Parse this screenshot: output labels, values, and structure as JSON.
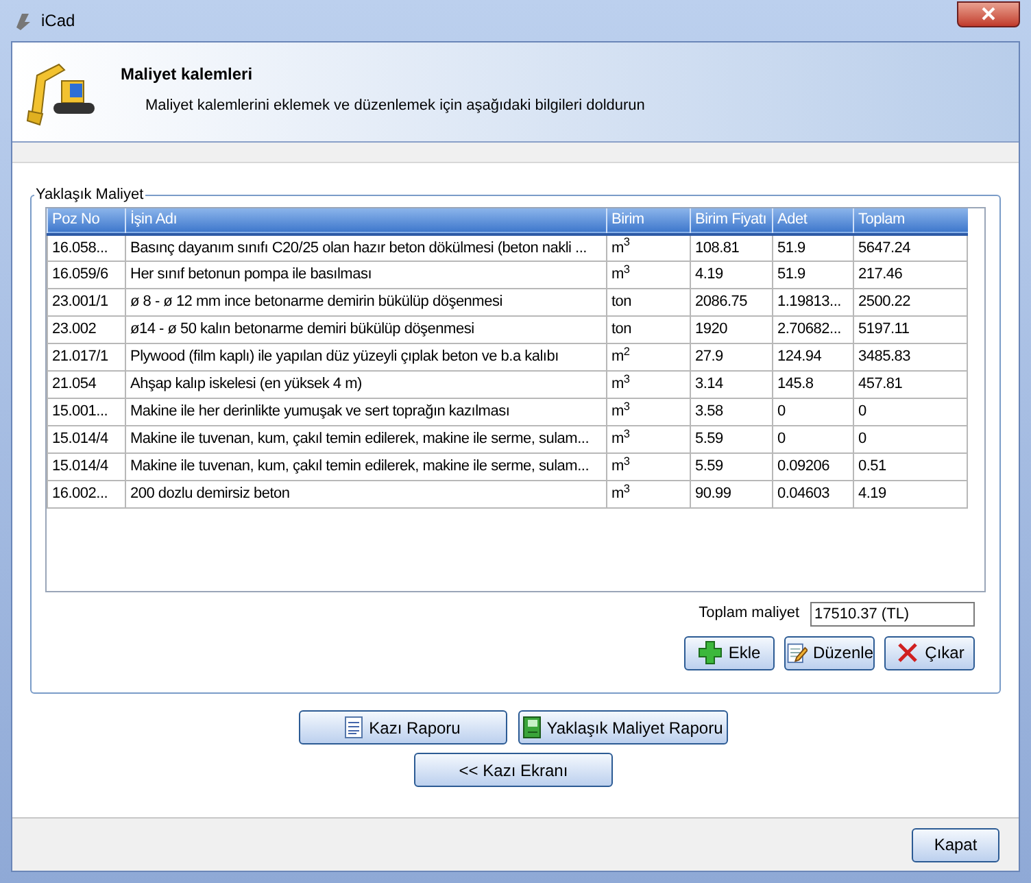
{
  "window": {
    "title": "iCad"
  },
  "header": {
    "title": "Maliyet kalemleri",
    "subtitle": "Maliyet kalemlerini eklemek ve düzenlemek için aşağıdaki bilgileri doldurun"
  },
  "group": {
    "title": "Yaklaşık Maliyet"
  },
  "table": {
    "columns": [
      "Poz No",
      "İşin Adı",
      "Birim",
      "Birim Fiyatı",
      "Adet",
      "Toplam"
    ],
    "rows": [
      [
        "16.058...",
        "Basınç dayanım sınıfı C20/25 olan hazır beton dökülmesi (beton nakli ...",
        "m$^{3}$",
        "108.81",
        "51.9",
        "5647.24"
      ],
      [
        "16.059/6",
        "Her sınıf betonun pompa ile basılması",
        "m$^{3}$",
        "4.19",
        "51.9",
        "217.46"
      ],
      [
        "23.001/1",
        "ø 8 - ø 12 mm ince betonarme demirin bükülüp döşenmesi",
        "ton",
        "2086.75",
        "1.19813...",
        "2500.22"
      ],
      [
        "23.002",
        "ø14 - ø 50 kalın betonarme demiri bükülüp döşenmesi",
        "ton",
        "1920",
        "2.70682...",
        "5197.11"
      ],
      [
        "21.017/1",
        "Plywood (film kaplı) ile yapılan düz yüzeyli çıplak beton ve b.a kalıbı",
        "m$^{2}$",
        "27.9",
        "124.94",
        "3485.83"
      ],
      [
        "21.054",
        "Ahşap kalıp iskelesi (en yüksek 4 m)",
        "m$^{3}$",
        "3.14",
        "145.8",
        "457.81"
      ],
      [
        "15.001...",
        "Makine ile her derinlikte yumuşak ve sert toprağın kazılması",
        "m$^{3}$",
        "3.58",
        "0",
        "0"
      ],
      [
        "15.014/4",
        "Makine ile tuvenan, kum, çakıl temin edilerek, makine ile serme, sulam...",
        "m$^{3}$",
        "5.59",
        "0",
        "0"
      ],
      [
        "15.014/4",
        "Makine ile tuvenan, kum, çakıl temin edilerek, makine ile serme, sulam...",
        "m$^{3}$",
        "5.59",
        "0.09206",
        "0.51"
      ],
      [
        "16.002...",
        "200 dozlu demirsiz beton",
        "m$^{3}$",
        "90.99",
        "0.04603",
        "4.19"
      ]
    ]
  },
  "total": {
    "label": "Toplam maliyet",
    "value": "17510.37 (TL)"
  },
  "actions": [
    {
      "kind": "add",
      "label": "Ekle"
    },
    {
      "kind": "edit",
      "label": "Düzenle"
    },
    {
      "kind": "remove",
      "label": "Çıkar"
    }
  ],
  "reports": [
    {
      "kind": "doc",
      "label": "Kazı Raporu"
    },
    {
      "kind": "book",
      "label": "Yaklaşık Maliyet Raporu"
    }
  ],
  "back_button": "<< Kazı Ekranı",
  "close_button": "Kapat"
}
